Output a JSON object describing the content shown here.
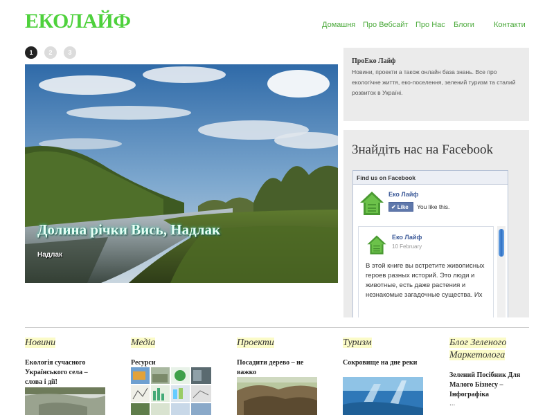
{
  "site": {
    "logo": "ЕКОЛАЙФ"
  },
  "nav": {
    "items": [
      "Домашня",
      "Про Вебсайт",
      "Про Нас",
      "Блоги",
      "Контакти"
    ]
  },
  "slider": {
    "dots": [
      "1",
      "2",
      "3"
    ],
    "active": 0,
    "title": "Долина річки Вись, Надлак",
    "subtitle": "Надлак"
  },
  "about": {
    "title": "ПроЕко Лайф",
    "text": "Новини, проекти а також онлайн база знань. Все про екологічне життя, еко-поселення, зелений туризм та сталий розвиток в Україні."
  },
  "facebook": {
    "widget_title": "Знайдіть нас на Facebook",
    "header": "Find us on Facebook",
    "page_name": "Еко Лайф",
    "like_label": "Like",
    "like_status": "You like this.",
    "post": {
      "author": "Еко Лайф",
      "date": "10 February",
      "text": "В этой книге вы встретите живописных героев разных историй. Это люди и животные, есть даже растения и незнакомые загадочные существа. Их"
    }
  },
  "columns": [
    {
      "title": "Новини",
      "link": "Екологія сучасного Українського села – слова і дії!"
    },
    {
      "title": "Медіа",
      "link": "Ресурси"
    },
    {
      "title": "Проекти",
      "link": "Посадити дерево – не важко"
    },
    {
      "title": "Туризм",
      "link": "Сокровище на дне реки"
    },
    {
      "title": "Блог Зеленого Маркетолога",
      "link": "Зелений Посібник Для Малого Бізнесу – Інфографіка",
      "extra": "..."
    }
  ]
}
